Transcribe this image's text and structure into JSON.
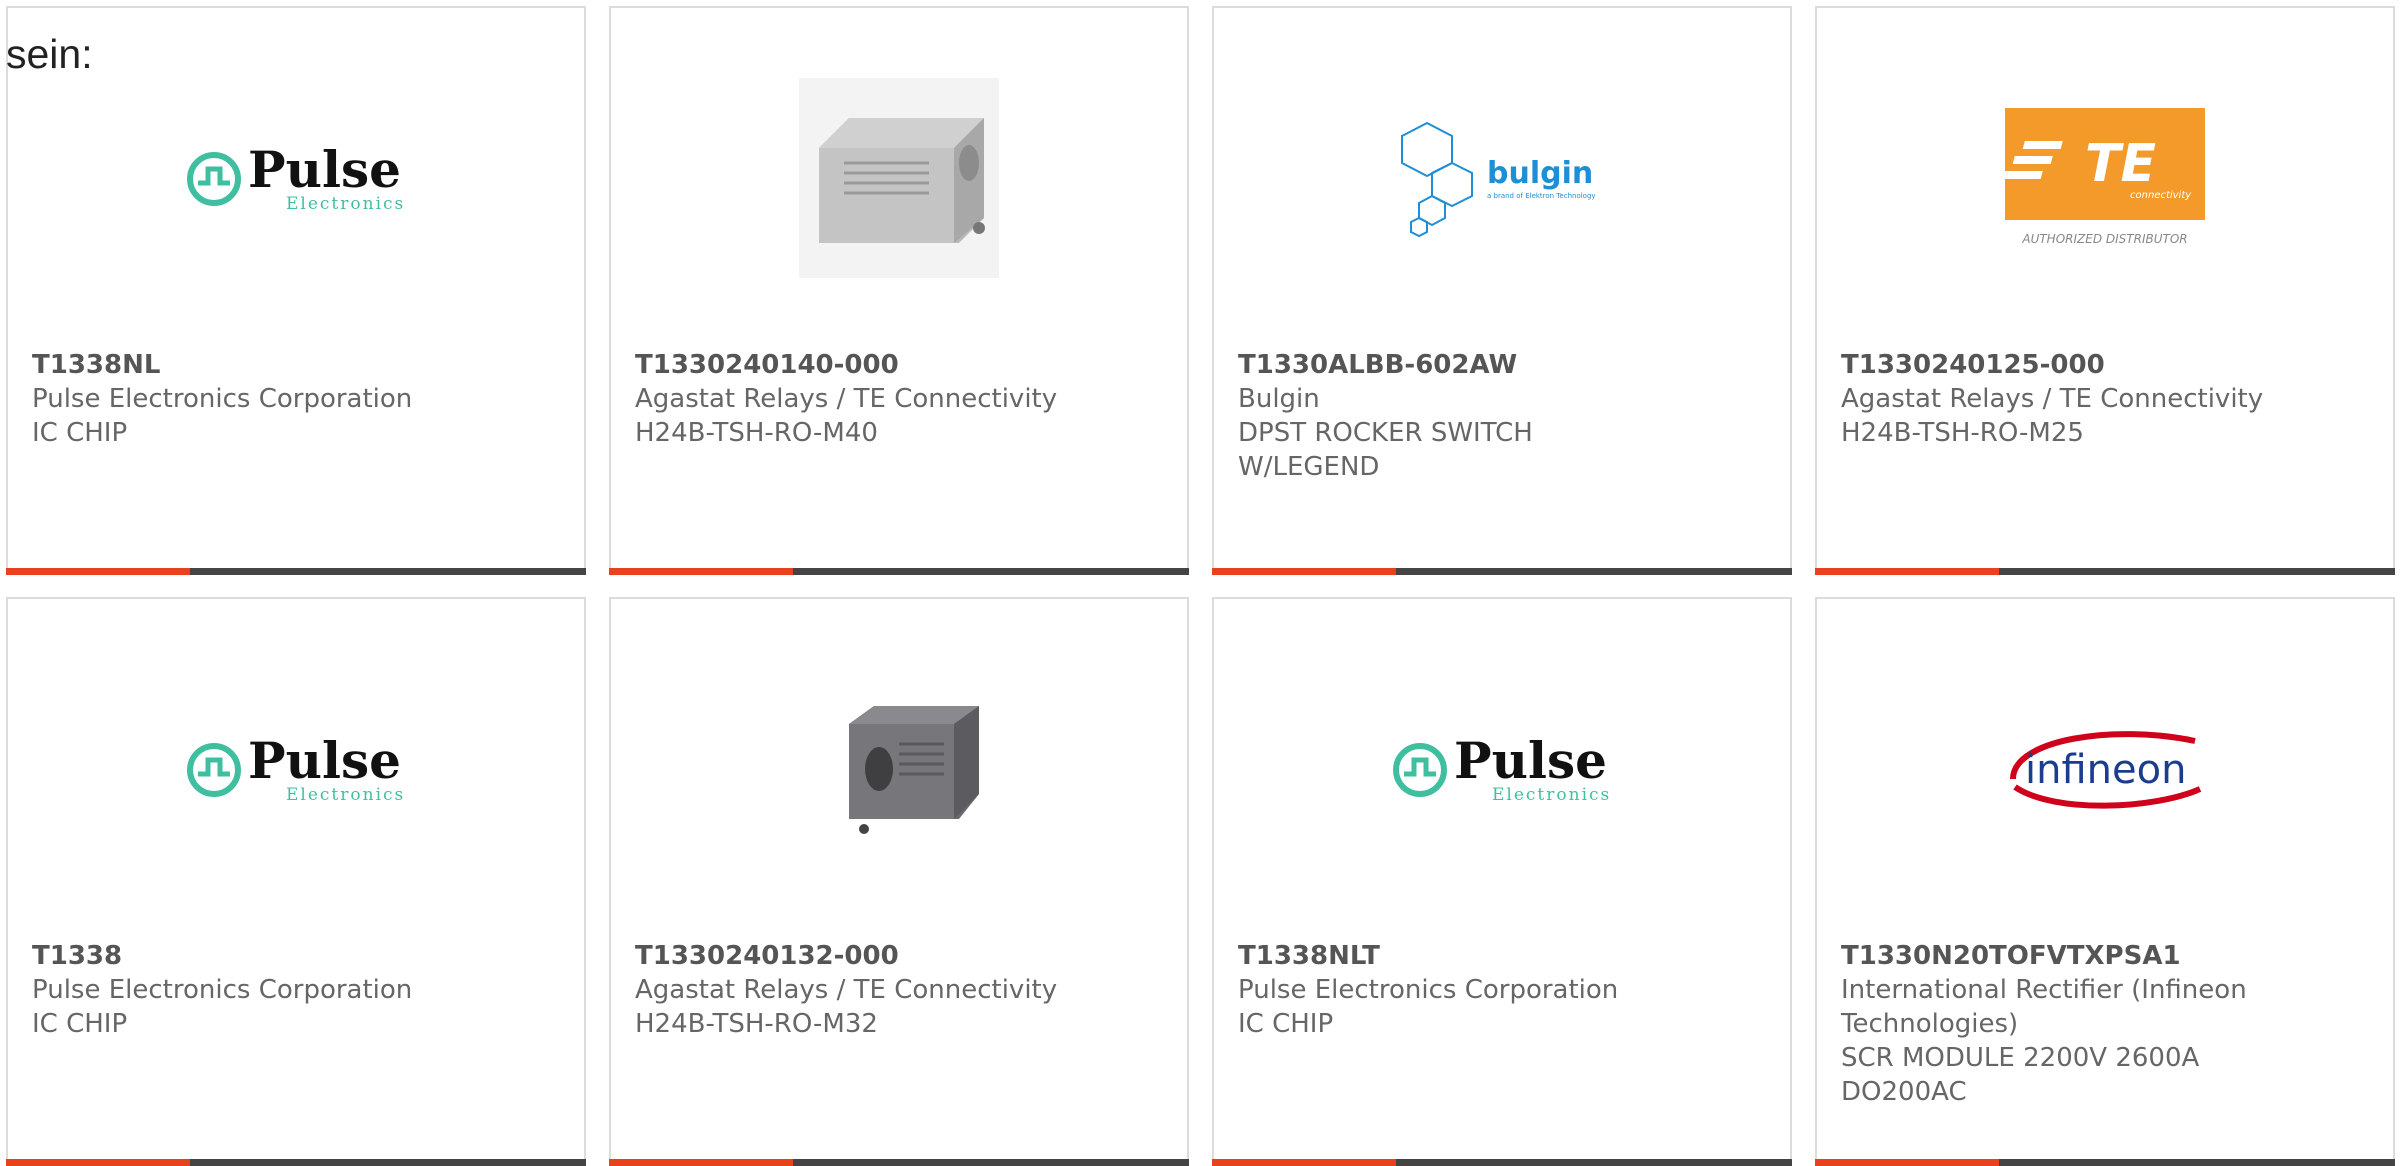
{
  "intro_text": "sein:",
  "colors": {
    "accent": "#e8411c",
    "bar": "#444444",
    "pulse_teal": "#3fbf9f",
    "te_orange": "#f39a2b",
    "infineon_red": "#d0021b",
    "infineon_blue": "#1a3d8f",
    "bulgin_blue": "#1e8fd6"
  },
  "products": [
    {
      "part": "T1338NL",
      "maker": "Pulse Electronics Corporation",
      "desc": "IC CHIP",
      "logo": "pulse",
      "logo_text": {
        "main": "Pulse",
        "sub": "Electronics"
      }
    },
    {
      "part": "T1330240140-000",
      "maker": "Agastat Relays / TE Connectivity",
      "desc": "H24B-TSH-RO-M40",
      "logo": "housing-light"
    },
    {
      "part": "T1330ALBB-602AW",
      "maker": "Bulgin",
      "desc": "DPST ROCKER SWITCH W/LEGEND",
      "logo": "bulgin",
      "logo_text": {
        "main": "bulgin",
        "sub": "a brand of Elektron Technology"
      }
    },
    {
      "part": "T1330240125-000",
      "maker": "Agastat Relays / TE Connectivity",
      "desc": "H24B-TSH-RO-M25",
      "logo": "te",
      "logo_text": {
        "main": "TE",
        "sub": "connectivity",
        "caption": "AUTHORIZED DISTRIBUTOR"
      }
    },
    {
      "part": "T1338",
      "maker": "Pulse Electronics Corporation",
      "desc": "IC CHIP",
      "logo": "pulse",
      "logo_text": {
        "main": "Pulse",
        "sub": "Electronics"
      }
    },
    {
      "part": "T1330240132-000",
      "maker": "Agastat Relays / TE Connectivity",
      "desc": "H24B-TSH-RO-M32",
      "logo": "housing-dark"
    },
    {
      "part": "T1338NLT",
      "maker": "Pulse Electronics Corporation",
      "desc": "IC CHIP",
      "logo": "pulse",
      "logo_text": {
        "main": "Pulse",
        "sub": "Electronics"
      }
    },
    {
      "part": "T1330N20TOFVTXPSA1",
      "maker": "International Rectifier (Infineon Technologies)",
      "desc": "SCR MODULE 2200V 2600A DO200AC",
      "logo": "infineon",
      "logo_text": {
        "main": "infineon"
      }
    }
  ]
}
